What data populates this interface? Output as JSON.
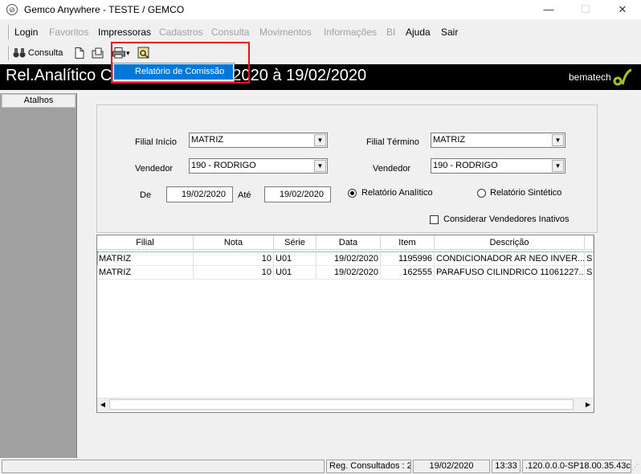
{
  "window": {
    "title": "Gemco Anywhere - TESTE / GEMCO",
    "minimize": "—",
    "maximize": "☐",
    "close": "✕"
  },
  "menu": [
    {
      "label": "Login",
      "enabled": true
    },
    {
      "label": "Favoritos",
      "enabled": false
    },
    {
      "label": "Impressoras",
      "enabled": true
    },
    {
      "label": "Cadastros",
      "enabled": false
    },
    {
      "label": "Consulta",
      "enabled": false
    },
    {
      "label": "Movimentos",
      "enabled": false
    },
    {
      "label": "Informações",
      "enabled": false
    },
    {
      "label": "BI",
      "enabled": false
    },
    {
      "label": "Ajuda",
      "enabled": true
    },
    {
      "label": "Sair",
      "enabled": true
    }
  ],
  "toolbar": {
    "consulta_label": "Consulta",
    "dropdown_arrow": "▾"
  },
  "dropdown": {
    "item": "Relatório de Comissão"
  },
  "banner": {
    "title": "Rel.Analítico Co                         or - De : 19/02/2020 à 19/02/2020",
    "logo": "bematech"
  },
  "sidebar": {
    "header": "Atalhos"
  },
  "filters": {
    "filial_inicio_label": "Filial Início",
    "filial_inicio_value": "MATRIZ",
    "filial_termino_label": "Filial Término",
    "filial_termino_value": "MATRIZ",
    "vendedor1_label": "Vendedor",
    "vendedor1_value": "190 - RODRIGO",
    "vendedor2_label": "Vendedor",
    "vendedor2_value": "190 - RODRIGO",
    "de_label": "De",
    "de_value": "19/02/2020",
    "ate_label": "Até",
    "ate_value": "19/02/2020",
    "radio_analitico": "Relatório Analítico",
    "radio_sintetico": "Relatório Sintético",
    "checkbox_label": "Considerar Vendedores Inativos"
  },
  "grid": {
    "headers": [
      "Filial",
      "Nota",
      "Série",
      "Data",
      "Item",
      "Descrição"
    ],
    "rows": [
      [
        "MATRIZ",
        "10",
        "U01",
        "19/02/2020",
        "1195996",
        "CONDICIONADOR AR NEO INVER...",
        "S"
      ],
      [
        "MATRIZ",
        "10",
        "U01",
        "19/02/2020",
        "162555",
        "PARAFUSO CILINDRICO 11061227...",
        "S"
      ]
    ]
  },
  "status": {
    "reg": "Reg. Consultados : 2",
    "date": "19/02/2020",
    "time": "13:33",
    "version": ".120.0.0.0-SP18.00.35.43c"
  }
}
